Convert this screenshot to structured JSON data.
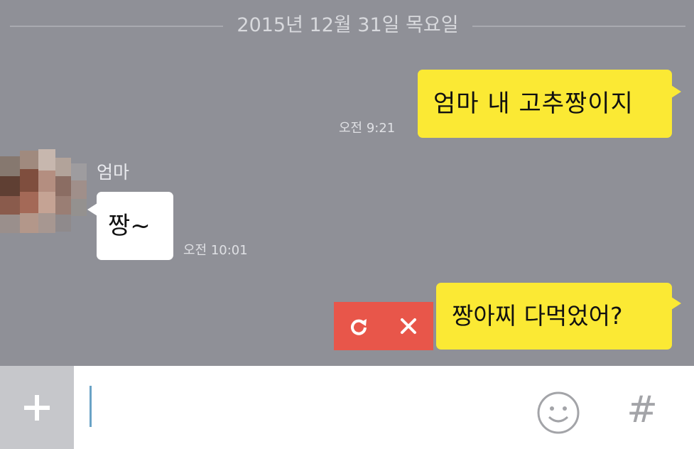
{
  "chat": {
    "date_divider": "2015년 12월 31일 목요일",
    "messages": [
      {
        "from": "me",
        "text": "엄마 내 고추짱이지",
        "time": "오전 9:21"
      },
      {
        "from": "엄마",
        "text": "짱~",
        "time": "오전 10:01"
      },
      {
        "from": "me",
        "text": "짱아찌 다먹었어?",
        "status": "failed"
      }
    ]
  },
  "input_bar": {
    "plus_icon": "plus-icon",
    "emoji_icon": "smiley-icon",
    "hash_label": "#"
  },
  "colors": {
    "chat_background": "#8f9097",
    "my_bubble": "#fbe934",
    "their_bubble": "#ffffff",
    "failed_badge": "#e8564a"
  }
}
